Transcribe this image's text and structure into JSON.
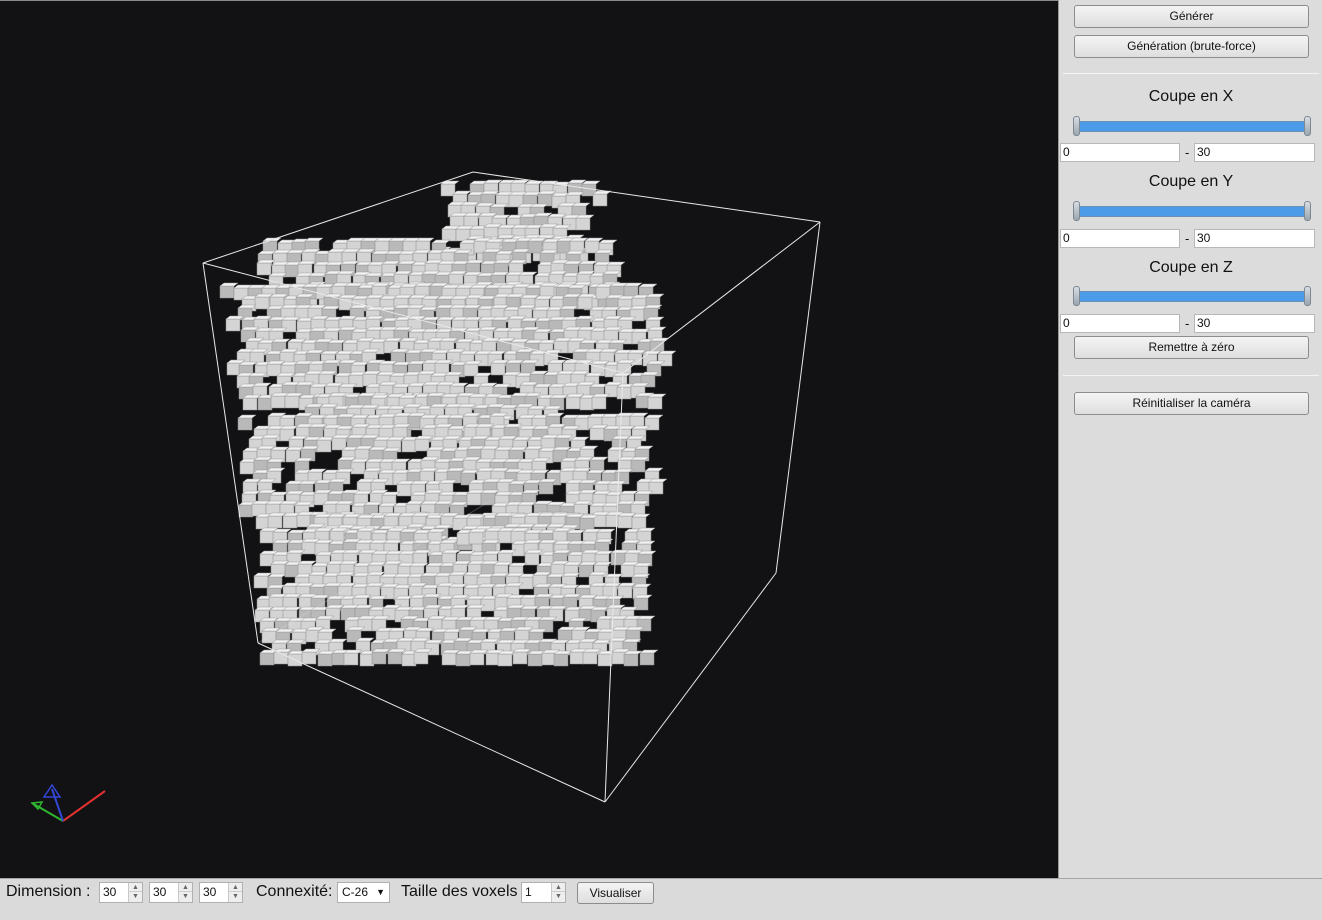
{
  "panel": {
    "generate_label": "Générer",
    "brute_force_label": "Génération (brute-force)",
    "cut_x": {
      "title": "Coupe en X",
      "min": "0",
      "max": "30",
      "range_fill": 1.0
    },
    "cut_y": {
      "title": "Coupe en Y",
      "min": "0",
      "max": "30",
      "range_fill": 1.0
    },
    "cut_z": {
      "title": "Coupe en Z",
      "min": "0",
      "max": "30",
      "range_fill": 1.0
    },
    "range_separator": "-",
    "reset_label": "Remettre à zéro",
    "reset_camera_label": "Réinitialiser la caméra"
  },
  "bottom": {
    "dimension_label": "Dimension :",
    "dim_x": "30",
    "dim_y": "30",
    "dim_z": "30",
    "connectivity_label": "Connexité:",
    "connectivity_value": "C-26",
    "voxel_size_label": "Taille des voxels",
    "voxel_size_value": "1",
    "visualize_label": "Visualiser"
  },
  "colors": {
    "viewport_bg": "#121214",
    "slider_fill": "#4c9be8",
    "voxel_top": "#f2f2f2",
    "voxel_side": "#d4d4d4",
    "voxel_dark": "#b9b9b9",
    "axis_x": "#e23030",
    "axis_y": "#2fb52f",
    "axis_z": "#3346d6"
  }
}
